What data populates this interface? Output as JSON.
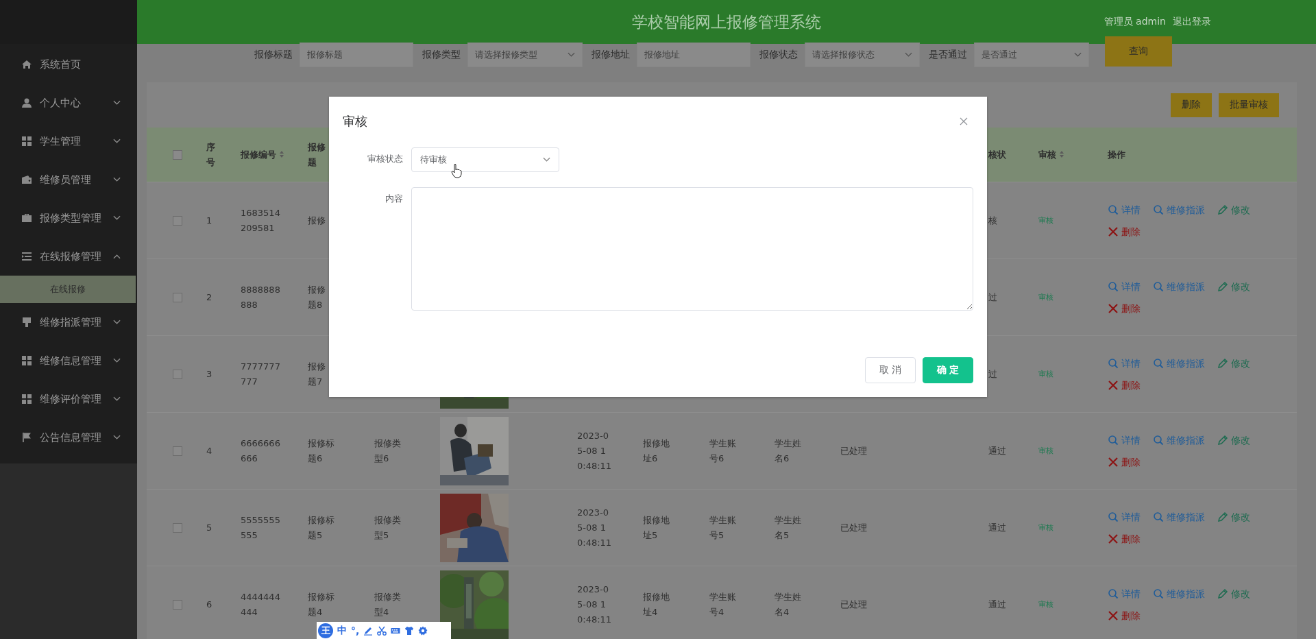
{
  "header": {
    "title": "学校智能网上报修管理系统",
    "user": "管理员 admin",
    "logout": "退出登录"
  },
  "sidebar": {
    "items": [
      {
        "label": "系统首页",
        "kind": "home"
      },
      {
        "label": "个人中心",
        "kind": "user",
        "expanded": false
      },
      {
        "label": "学生管理",
        "kind": "grid",
        "expanded": false
      },
      {
        "label": "维修员管理",
        "kind": "wallet",
        "expanded": false
      },
      {
        "label": "报修类型管理",
        "kind": "briefcase",
        "expanded": false
      },
      {
        "label": "在线报修管理",
        "kind": "list",
        "expanded": true,
        "children": [
          {
            "label": "在线报修",
            "selected": true
          }
        ]
      },
      {
        "label": "维修指派管理",
        "kind": "brush",
        "expanded": false
      },
      {
        "label": "维修信息管理",
        "kind": "grid",
        "expanded": false
      },
      {
        "label": "维修评价管理",
        "kind": "grid",
        "expanded": false
      },
      {
        "label": "公告信息管理",
        "kind": "flag",
        "expanded": false
      }
    ]
  },
  "search": {
    "fields": [
      {
        "label": "报修标题",
        "placeholder": "报修标题",
        "kind": "input"
      },
      {
        "label": "报修类型",
        "placeholder": "请选择报修类型",
        "kind": "select"
      },
      {
        "label": "报修地址",
        "placeholder": "报修地址",
        "kind": "input"
      },
      {
        "label": "报修状态",
        "placeholder": "请选择报修状态",
        "kind": "select"
      },
      {
        "label": "是否通过",
        "placeholder": "是否通过",
        "kind": "select"
      }
    ],
    "button": "查询"
  },
  "toolbar": {
    "buttons": [
      "删除",
      "批量审核"
    ]
  },
  "table": {
    "header_checked": false,
    "columns": [
      {
        "label": "序号",
        "sortable": false
      },
      {
        "label": "报修编号",
        "sortable": true
      },
      {
        "label_parts": [
          "报修",
          "题"
        ],
        "sortable": false
      },
      {},
      {},
      {},
      {},
      {},
      {},
      {},
      {
        "label": "核状",
        "sortable": false
      },
      {
        "label": "审核",
        "sortable": true
      },
      {
        "label": "操作",
        "sortable": false
      }
    ],
    "rows": [
      {
        "checked": false,
        "index": "1",
        "code": "1683514209581",
        "title": "报修",
        "audit_status": "核",
        "audit": "审核",
        "actions": [
          {
            "label": "详情",
            "kind": "view"
          },
          {
            "label": "维修指派",
            "kind": "view"
          },
          {
            "label": "修改",
            "kind": "edit"
          },
          {
            "label": "删除",
            "kind": "delete"
          }
        ]
      },
      {
        "checked": false,
        "index": "2",
        "code": "8888888888",
        "title_parts": [
          "报修",
          "题8"
        ],
        "audit_status": "过",
        "audit": "审核",
        "actions": [
          {
            "label": "详情",
            "kind": "view"
          },
          {
            "label": "维修指派",
            "kind": "view"
          },
          {
            "label": "修改",
            "kind": "edit"
          },
          {
            "label": "删除",
            "kind": "delete"
          }
        ]
      },
      {
        "checked": false,
        "index": "3",
        "code": "7777777777",
        "title_parts": [
          "报修",
          "题7"
        ],
        "image": {
          "kind": "picture"
        },
        "audit_status": "过",
        "audit": "审核",
        "actions": [
          {
            "label": "详情",
            "kind": "view"
          },
          {
            "label": "维修指派",
            "kind": "view"
          },
          {
            "label": "修改",
            "kind": "edit"
          },
          {
            "label": "删除",
            "kind": "delete"
          }
        ]
      },
      {
        "checked": false,
        "index": "4",
        "code": "6666666666",
        "title": "报修标题6",
        "type": "报修类型6",
        "image": {
          "kind": "picture"
        },
        "time": "2023-05-08 10:48:11",
        "address": "报修地址6",
        "account": "学生账号6",
        "name": "学生姓名6",
        "status": "已处理",
        "audit_status": "通过",
        "audit": "审核",
        "actions": [
          {
            "label": "详情",
            "kind": "view"
          },
          {
            "label": "维修指派",
            "kind": "view"
          },
          {
            "label": "修改",
            "kind": "edit"
          },
          {
            "label": "删除",
            "kind": "delete"
          }
        ]
      },
      {
        "checked": false,
        "index": "5",
        "code": "5555555555",
        "title": "报修标题5",
        "type": "报修类型5",
        "image": {
          "kind": "picture"
        },
        "time": "2023-05-08 10:48:11",
        "address": "报修地址5",
        "account": "学生账号5",
        "name": "学生姓名5",
        "status": "已处理",
        "audit_status": "通过",
        "audit": "审核",
        "actions": [
          {
            "label": "详情",
            "kind": "view"
          },
          {
            "label": "维修指派",
            "kind": "view"
          },
          {
            "label": "修改",
            "kind": "edit"
          },
          {
            "label": "删除",
            "kind": "delete"
          }
        ]
      },
      {
        "checked": false,
        "index": "6",
        "code": "4444444444",
        "title": "报修标题4",
        "type": "报修类型4",
        "image": {
          "kind": "picture"
        },
        "time": "2023-05-08 10:48:11",
        "address": "报修地址4",
        "account": "学生账号4",
        "name": "学生姓名4",
        "status": "已处理",
        "audit_status": "通过",
        "audit": "审核",
        "actions": [
          {
            "label": "详情",
            "kind": "view"
          },
          {
            "label": "维修指派",
            "kind": "view"
          },
          {
            "label": "修改",
            "kind": "edit"
          },
          {
            "label": "删除",
            "kind": "delete"
          }
        ]
      }
    ]
  },
  "dialog": {
    "title": "审核",
    "fields": [
      {
        "label": "审核状态",
        "kind": "select",
        "value": "待审核"
      },
      {
        "label": "内容",
        "kind": "textarea"
      }
    ],
    "buttons": [
      {
        "label": "取 消",
        "kind": "default"
      },
      {
        "label": "确 定",
        "kind": "primary"
      }
    ]
  },
  "ime": {
    "logo": "王",
    "mode": "中",
    "punctuation": "°,"
  }
}
